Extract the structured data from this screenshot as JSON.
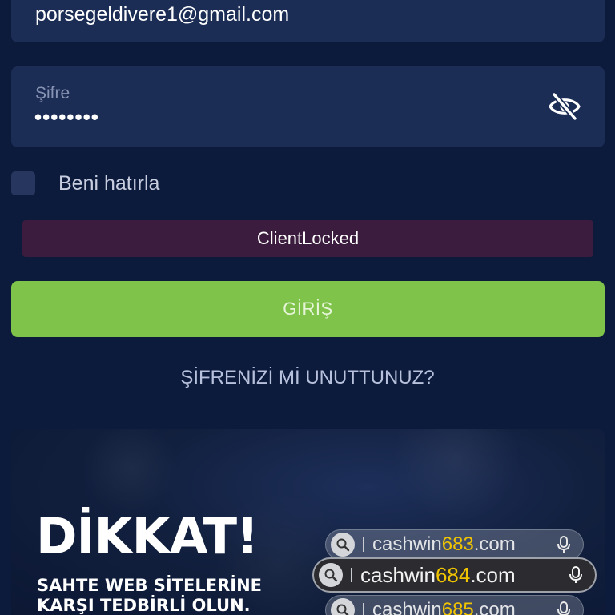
{
  "login_form": {
    "email_value": "porsegeldivere1@gmail.com",
    "password_label": "Şifre",
    "password_value": "••••••••",
    "remember_label": "Beni hatırla",
    "error_message": "ClientLocked",
    "login_button_label": "GİRİŞ",
    "forgot_password_label": "ŞİFRENİZİ Mİ UNUTTUNUZ?"
  },
  "banner": {
    "title": "DİKKAT!",
    "subtitle_line1": "SAHTE WEB SİTELERİNE",
    "subtitle_line2": "KARŞI TEDBİRLİ OLUN.",
    "domains": [
      {
        "prefix": "cashwin",
        "number": "683",
        "suffix": ".com"
      },
      {
        "prefix": "cashwin",
        "number": "684",
        "suffix": ".com"
      },
      {
        "prefix": "cashwin",
        "number": "685",
        "suffix": ".com"
      }
    ],
    "highlight_color": "#f0c400"
  },
  "colors": {
    "background": "#0c1a3c",
    "field": "#1c2d55",
    "error_banner": "#3c1c3e",
    "login_button": "#7fc34b"
  },
  "icons": {
    "password_toggle": "eye-slash-icon",
    "search": "search-icon",
    "mic": "microphone-icon"
  }
}
